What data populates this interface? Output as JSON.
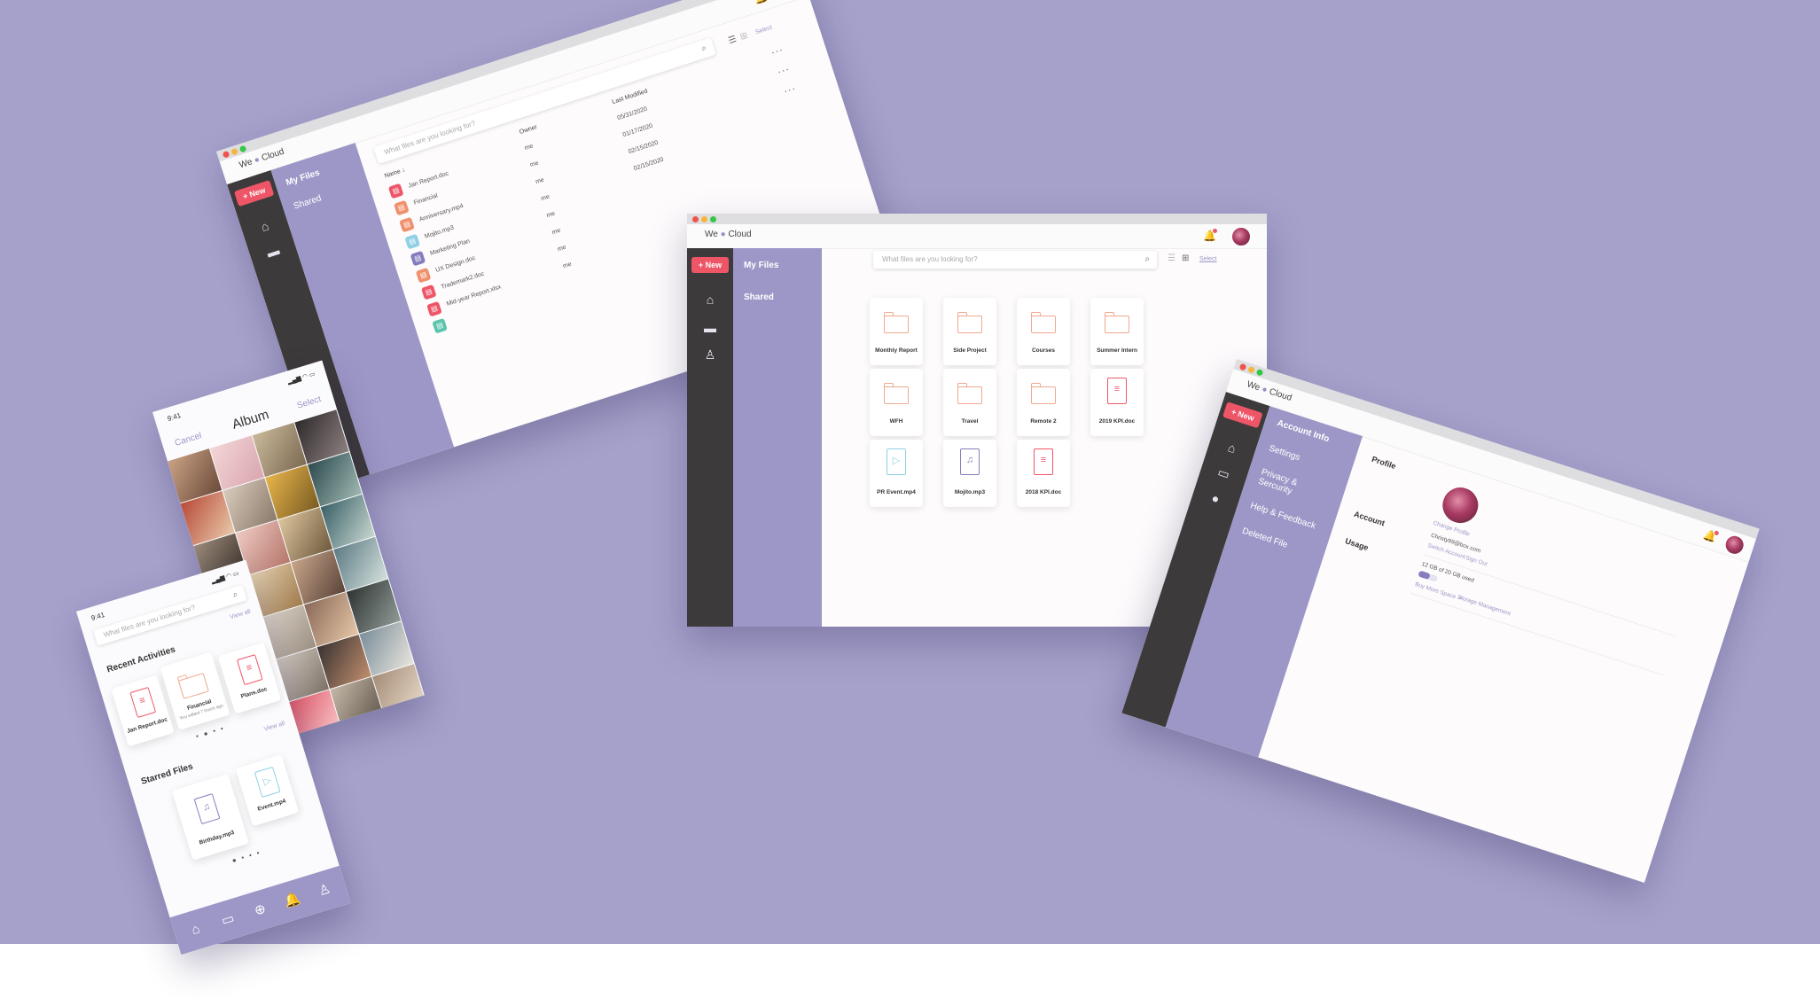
{
  "app": {
    "logo_left": "We",
    "logo_right": "Cloud",
    "new_button": "+ New"
  },
  "nav": {
    "my_files": "My Files",
    "shared": "Shared"
  },
  "search_placeholder": "What files are you looking for?",
  "view": {
    "select": "Select"
  },
  "center": {
    "tiles": [
      {
        "label": "Monthly Report",
        "kind": "folder"
      },
      {
        "label": "Side Project",
        "kind": "folder"
      },
      {
        "label": "Courses",
        "kind": "folder"
      },
      {
        "label": "Summer Intern",
        "kind": "folder"
      },
      {
        "label": "WFH",
        "kind": "folder"
      },
      {
        "label": "Travel",
        "kind": "folder"
      },
      {
        "label": "Remote 2",
        "kind": "folder"
      },
      {
        "label": "2019 KPI.doc",
        "kind": "doc"
      },
      {
        "label": "PR Event.mp4",
        "kind": "video"
      },
      {
        "label": "Mojito.mp3",
        "kind": "audio"
      },
      {
        "label": "2018 KPI.doc",
        "kind": "doc"
      }
    ]
  },
  "list": {
    "headers": {
      "name": "Name ↓",
      "owner": "Owner",
      "modified": "Last Modified"
    },
    "rows": [
      {
        "name": "Jan Report.doc",
        "owner": "me",
        "date": "05/31/2020",
        "icon_color": "#ee5668"
      },
      {
        "name": "Financial",
        "owner": "me",
        "date": "01/17/2020",
        "icon_color": "#f0916d"
      },
      {
        "name": "Anniversary.mp4",
        "owner": "me",
        "date": "02/15/2020",
        "icon_color": "#f0916d"
      },
      {
        "name": "Mojito.mp3",
        "owner": "me",
        "date": "02/15/2020",
        "icon_color": "#8fd0e6"
      },
      {
        "name": "Marketing Plan",
        "owner": "me",
        "date": "",
        "icon_color": "#857dbd"
      },
      {
        "name": "UX Design.doc",
        "owner": "me",
        "date": "",
        "icon_color": "#f0916d"
      },
      {
        "name": "Trademark2.doc",
        "owner": "me",
        "date": "",
        "icon_color": "#ee5668"
      },
      {
        "name": "Mid-year Report.xlsx",
        "owner": "me",
        "date": "",
        "icon_color": "#ee5668"
      },
      {
        "name": "",
        "owner": "",
        "date": "",
        "icon_color": "#5dc4ad"
      }
    ]
  },
  "settings": {
    "menu": [
      "Account Info",
      "Settings",
      "Privacy & Sercurity",
      "Help & Feedback",
      "Deleted File"
    ],
    "profile_label": "Profile",
    "change_profile": "Change Profile",
    "account_label": "Account",
    "email": "Christy99@box.com",
    "switch_account": "Switch Account",
    "sign_out": "Sign Out",
    "usage_label": "Usage",
    "usage_text": "12 GB of 20 GB used",
    "usage_fraction": 0.6,
    "buy_more": "Buy More Space ↗",
    "storage_mgmt": "Storage Management"
  },
  "album": {
    "time": "9:41",
    "cancel": "Cancel",
    "title": "Album",
    "select": "Select"
  },
  "home": {
    "time": "9:41",
    "view_all": "View all",
    "recent_title": "Recent Activities",
    "recent": [
      {
        "label": "Jan Report.doc"
      },
      {
        "label": "Financial",
        "sub": "You edited 7 hours ago"
      },
      {
        "label": "Plans.doc"
      }
    ],
    "starred_title": "Starred Files",
    "starred": [
      {
        "label": "Birthday.mp3"
      },
      {
        "label": "Event.mp4"
      }
    ]
  },
  "colors": {
    "accent": "#9d97c7",
    "new_button": "#ee5668",
    "rail": "#3d3a3b",
    "background": "#a5a1cb",
    "folder": "#f0a88e"
  }
}
